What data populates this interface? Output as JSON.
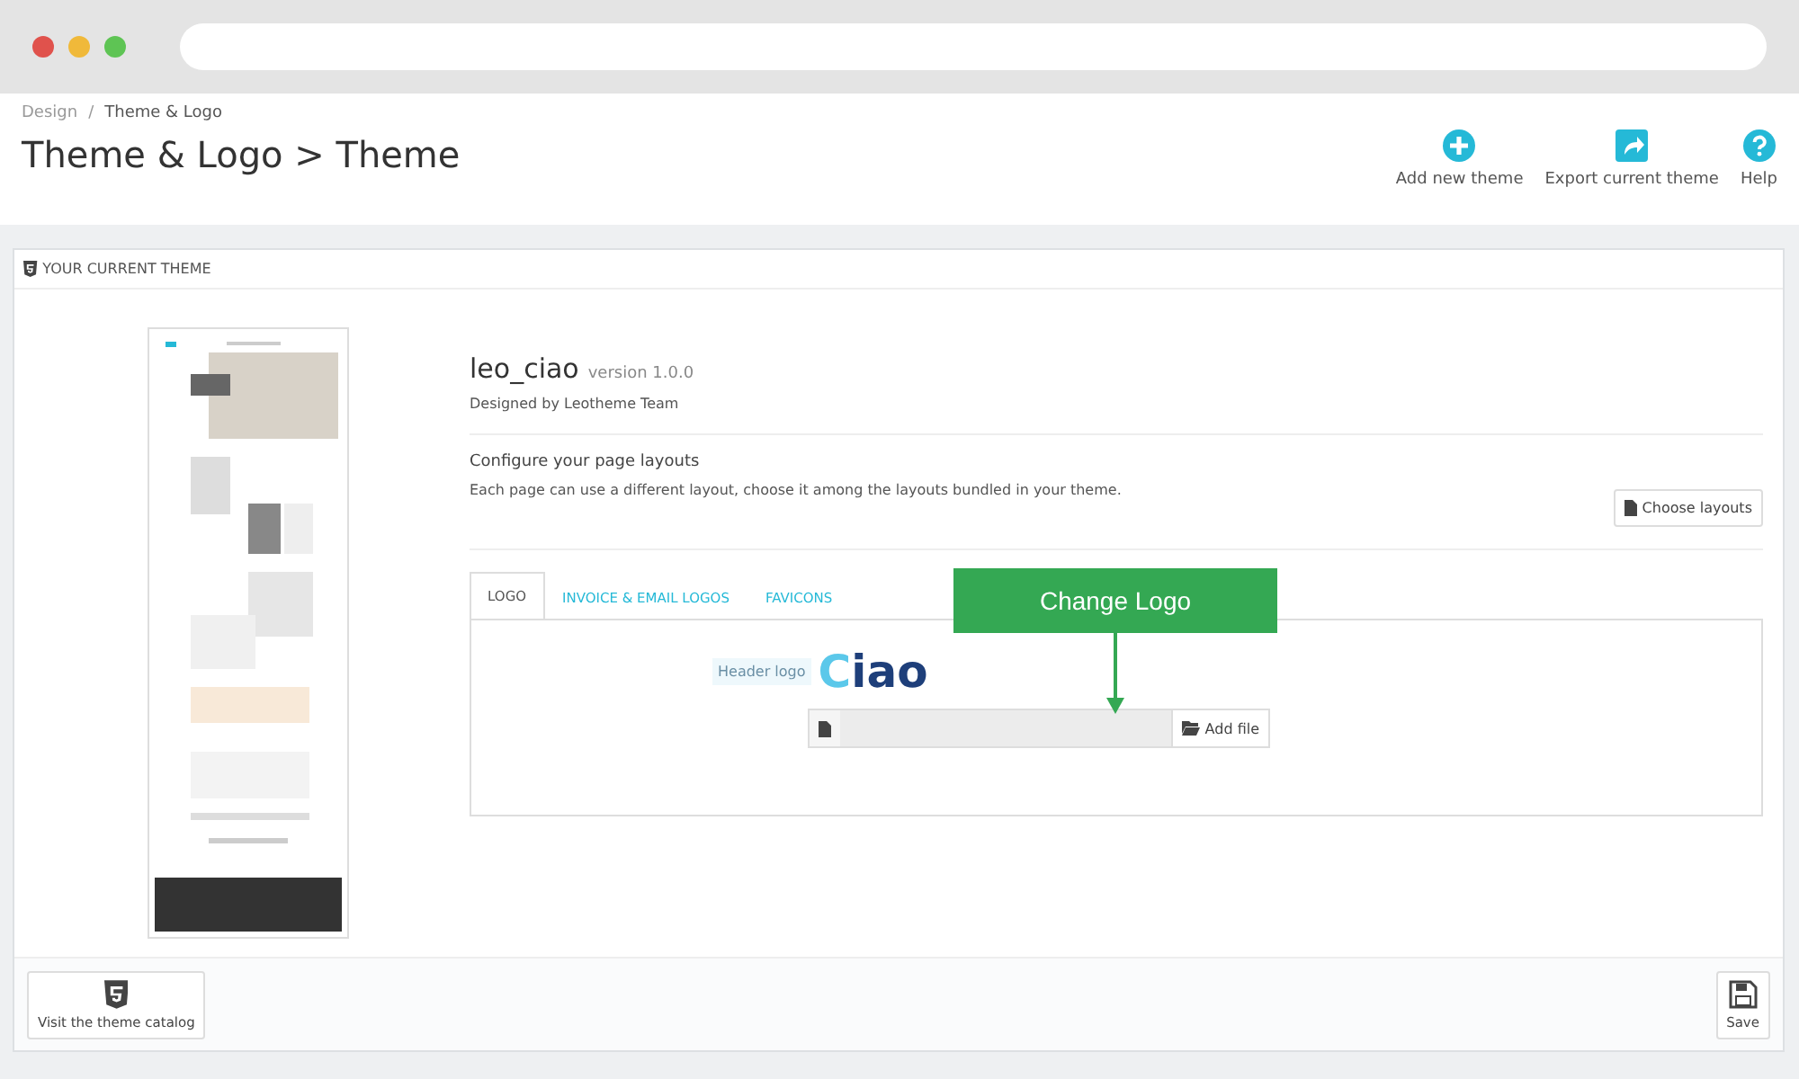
{
  "browser": {
    "dots": [
      {
        "color": "#e0524c"
      },
      {
        "color": "#f0b93a"
      },
      {
        "color": "#5ec454"
      }
    ]
  },
  "breadcrumb": {
    "items": [
      "Design",
      "Theme & Logo"
    ],
    "separator": "/"
  },
  "page_title": "Theme & Logo > Theme",
  "toolbar": [
    {
      "kind": "add",
      "label": "Add new theme"
    },
    {
      "kind": "export",
      "label": "Export current theme"
    },
    {
      "kind": "help",
      "label": "Help"
    }
  ],
  "panel": {
    "heading": "YOUR CURRENT THEME",
    "theme": {
      "name": "leo_ciao",
      "version": "version 1.0.0",
      "author": "Designed by Leotheme Team"
    },
    "layouts": {
      "title": "Configure your page layouts",
      "description": "Each page can use a different layout, choose it among the layouts bundled in your theme.",
      "button": "Choose layouts"
    },
    "tabs": [
      {
        "label": "LOGO",
        "selected": true
      },
      {
        "label": "INVOICE & EMAIL LOGOS",
        "selected": false
      },
      {
        "label": "FAVICONS",
        "selected": false
      }
    ],
    "logo": {
      "label": "Header logo",
      "logo_text": "Ciao",
      "button": "Add file"
    },
    "callout": "Change Logo",
    "footer": {
      "catalog_button": "Visit the theme catalog",
      "save_button": "Save"
    }
  }
}
